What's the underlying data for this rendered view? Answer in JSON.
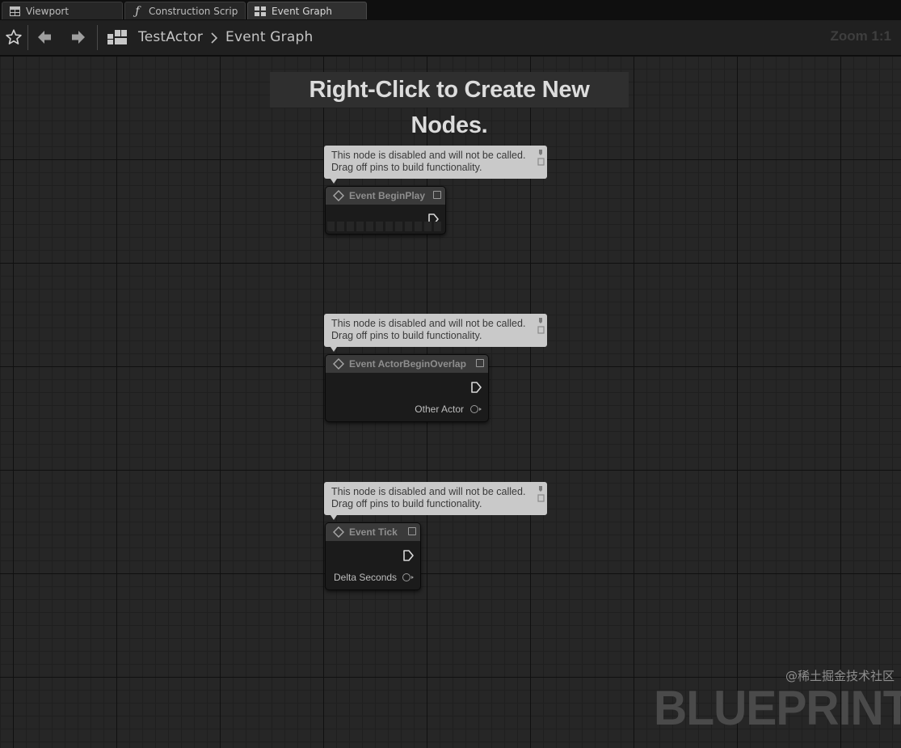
{
  "tabs": [
    {
      "label": "Viewport",
      "icon": "viewport-grid-icon"
    },
    {
      "label": "Construction Scrip",
      "icon": "function-icon"
    },
    {
      "label": "Event Graph",
      "icon": "graph-icon"
    }
  ],
  "toolbar": {
    "breadcrumb": [
      "TestActor",
      "Event Graph"
    ],
    "zoom": "Zoom 1:1"
  },
  "graph": {
    "hint": "Right-Click to Create New Nodes.",
    "comment_line1": "This node is disabled and will not be called.",
    "comment_line2": "Drag off pins to build functionality.",
    "nodes": [
      {
        "title": "Event BeginPlay",
        "pin": ""
      },
      {
        "title": "Event ActorBeginOverlap",
        "pin": "Other Actor"
      },
      {
        "title": "Event Tick",
        "pin": "Delta Seconds"
      }
    ],
    "watermark": "BLUEPRINT"
  },
  "credit": "@稀土掘金技术社区"
}
